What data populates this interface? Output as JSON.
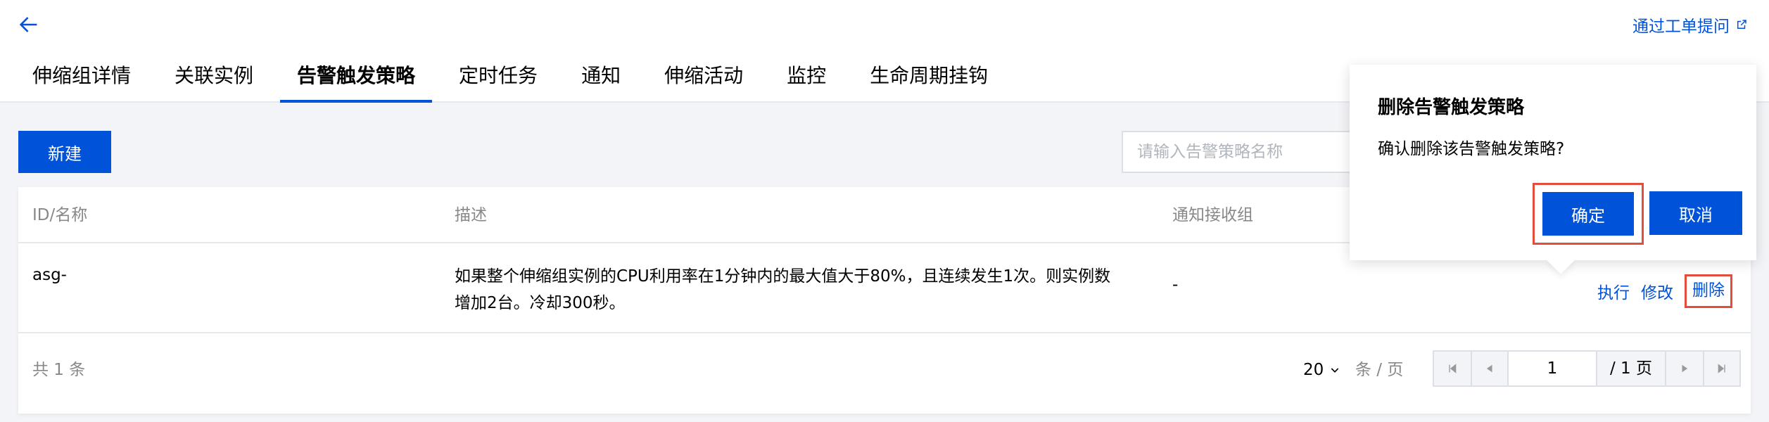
{
  "header": {
    "ticket_link": "通过工单提问",
    "tabs": [
      {
        "label": "伸缩组详情",
        "active": false
      },
      {
        "label": "关联实例",
        "active": false
      },
      {
        "label": "告警触发策略",
        "active": true
      },
      {
        "label": "定时任务",
        "active": false
      },
      {
        "label": "通知",
        "active": false
      },
      {
        "label": "伸缩活动",
        "active": false
      },
      {
        "label": "监控",
        "active": false
      },
      {
        "label": "生命周期挂钩",
        "active": false
      }
    ]
  },
  "toolbar": {
    "new_label": "新建",
    "search_placeholder": "请输入告警策略名称"
  },
  "table": {
    "columns": [
      "ID/名称",
      "描述",
      "通知接收组"
    ],
    "rows": [
      {
        "id_name": "asg-",
        "description_line1": "如果整个伸缩组实例的CPU利用率在1分钟内的最大值大于80%，且连续发生1次。则实例数",
        "description_line2": "增加2台。冷却300秒。",
        "notify_group": "-",
        "actions": [
          "执行",
          "修改",
          "删除"
        ]
      }
    ]
  },
  "footer": {
    "total": "共 1 条",
    "page_size": "20",
    "per_page_label": "条 / 页",
    "current_page": "1",
    "page_total": "/ 1 页"
  },
  "popover": {
    "title": "删除告警触发策略",
    "message": "确认删除该告警触发策略?",
    "confirm_label": "确定",
    "cancel_label": "取消"
  },
  "colors": {
    "primary": "#0052d9",
    "highlight_border": "#e34d3b"
  }
}
